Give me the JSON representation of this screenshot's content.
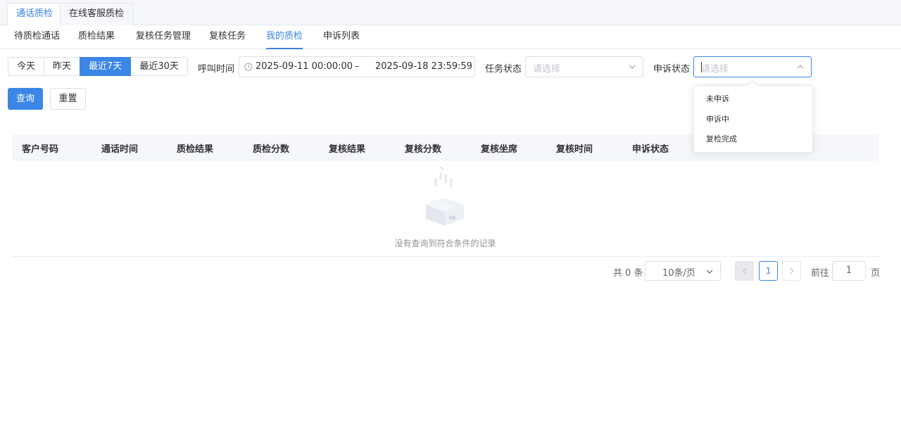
{
  "top_tabs": [
    {
      "label": "通话质检",
      "active": true
    },
    {
      "label": "在线客服质检",
      "active": false
    }
  ],
  "sub_nav": [
    {
      "label": "待质检通话"
    },
    {
      "label": "质检结果"
    },
    {
      "label": "复核任务管理"
    },
    {
      "label": "复核任务"
    },
    {
      "label": "我的质检",
      "active": true
    },
    {
      "label": "申诉列表"
    }
  ],
  "filters": {
    "range_buttons": [
      {
        "label": "今天"
      },
      {
        "label": "昨天"
      },
      {
        "label": "最近7天",
        "active": true
      },
      {
        "label": "最近30天"
      }
    ],
    "call_time_label": "呼叫时间",
    "call_time_start": "2025-09-11 00:00:00",
    "call_time_sep": "–",
    "call_time_end": "2025-09-18 23:59:59",
    "task_status_label": "任务状态",
    "task_status_placeholder": "请选择",
    "appeal_status_label": "申诉状态",
    "appeal_status_placeholder": "请选择",
    "query_label": "查询",
    "reset_label": "重置"
  },
  "appeal_dropdown": {
    "options": [
      "未申诉",
      "申诉中",
      "复检完成"
    ]
  },
  "table": {
    "columns": [
      "客户号码",
      "通话时间",
      "质检结果",
      "质检分数",
      "复核结果",
      "复核分数",
      "复核坐席",
      "复核时间",
      "申诉状态"
    ],
    "rows": [],
    "empty_text": "没有查询到符合条件的记录"
  },
  "pagination": {
    "total_text": "共 0 条",
    "page_size": "10条/页",
    "current_page": "1",
    "goto_label": "前往",
    "goto_value": "1",
    "page_unit": "页"
  },
  "colors": {
    "accent": "#3b86e6",
    "border": "#dcdfe6",
    "placeholder": "#c0c4cc"
  }
}
